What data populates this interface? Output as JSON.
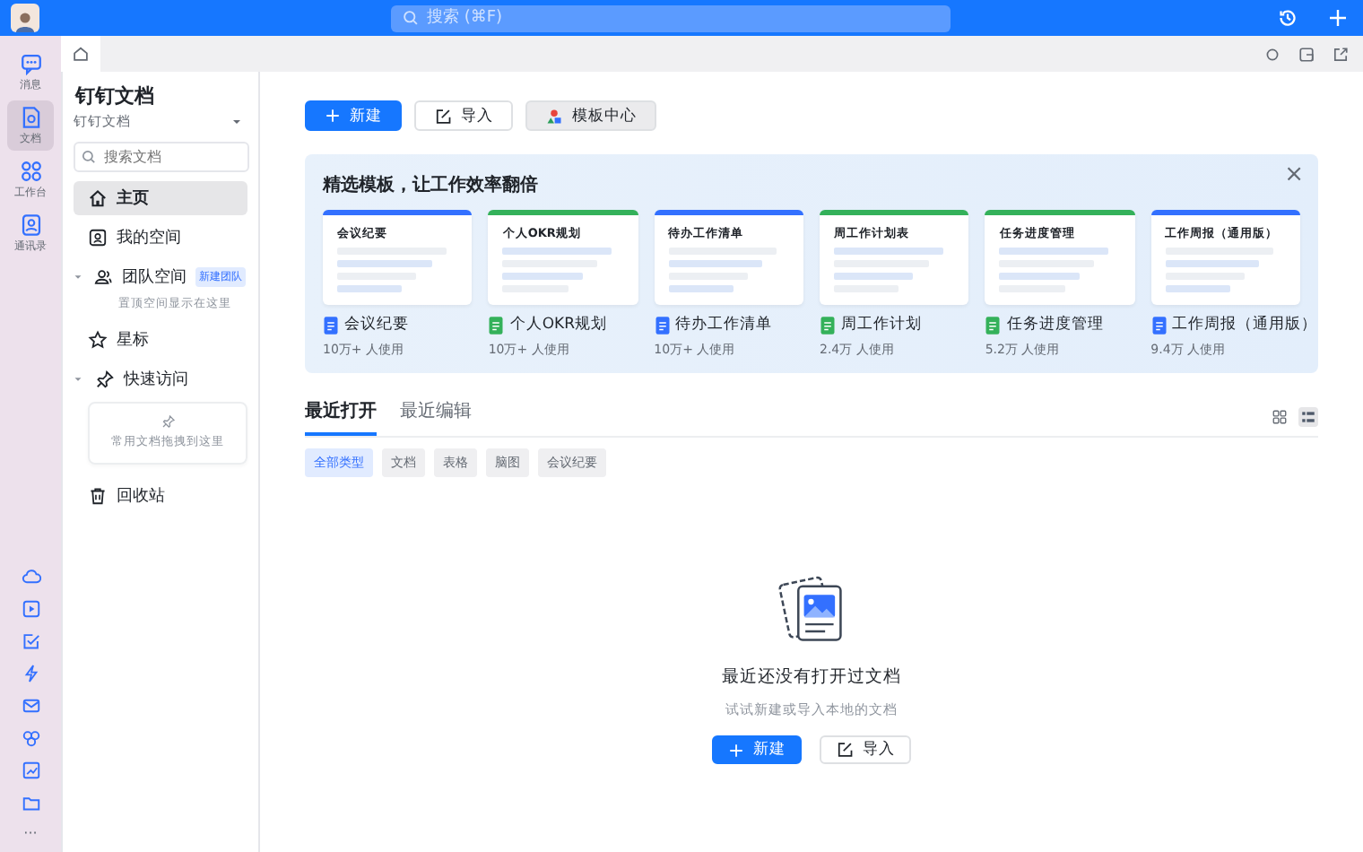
{
  "top_bar": {
    "search": {
      "placeholder": "搜索 (⌘F)"
    }
  },
  "rail": {
    "items": [
      {
        "label": "消息",
        "selected": false
      },
      {
        "label": "文档",
        "selected": true
      },
      {
        "label": "工作台",
        "selected": false
      },
      {
        "label": "通讯录",
        "selected": false
      }
    ],
    "more": "···"
  },
  "sidebar": {
    "title": "钉钉文档",
    "subtitle": "钉钉文档",
    "search": {
      "placeholder": "搜索文档"
    },
    "items": [
      {
        "kind": "nav",
        "label": "主页",
        "selected": true
      },
      {
        "kind": "nav",
        "label": "我的空间",
        "selected": false
      },
      {
        "kind": "group",
        "label": "团队空间",
        "expanded": true,
        "badge": "新建团队",
        "hint": "置顶空间显示在这里"
      },
      {
        "kind": "nav",
        "label": "星标",
        "selected": false
      },
      {
        "kind": "group",
        "label": "快速访问",
        "expanded": true,
        "drop_hint": "常用文档拖拽到这里"
      },
      {
        "kind": "nav",
        "label": "回收站",
        "selected": false
      }
    ]
  },
  "toolbar": {
    "buttons": [
      {
        "kind": "primary",
        "label": "新建"
      },
      {
        "kind": "import",
        "label": "导入"
      },
      {
        "kind": "template",
        "label": "模板中心"
      }
    ]
  },
  "banner": {
    "title": "精选模板，让工作效率翻倍",
    "close": "×",
    "cards": [
      {
        "kind": "doc",
        "preview_title": "会议纪要",
        "name": "会议纪要",
        "usage": "10万+ 人使用"
      },
      {
        "kind": "sheet",
        "preview_title": "个人OKR规划",
        "name": "个人OKR规划",
        "usage": "10万+ 人使用"
      },
      {
        "kind": "doc",
        "preview_title": "待办工作清单",
        "name": "待办工作清单",
        "usage": "10万+ 人使用"
      },
      {
        "kind": "sheet",
        "preview_title": "周工作计划表",
        "name": "周工作计划",
        "usage": "2.4万 人使用"
      },
      {
        "kind": "sheet",
        "preview_title": "任务进度管理",
        "name": "任务进度管理",
        "usage": "5.2万 人使用"
      },
      {
        "kind": "doc",
        "preview_title": "工作周报（通用版）",
        "name": "工作周报（通用版）",
        "usage": "9.4万 人使用"
      }
    ]
  },
  "recent": {
    "tabs": [
      {
        "label": "最近打开",
        "selected": true
      },
      {
        "label": "最近编辑",
        "selected": false
      }
    ],
    "views": [
      {
        "kind": "grid",
        "selected": false
      },
      {
        "kind": "list",
        "selected": true
      }
    ],
    "filters": [
      {
        "label": "全部类型",
        "selected": true
      },
      {
        "label": "文档",
        "selected": false
      },
      {
        "label": "表格",
        "selected": false
      },
      {
        "label": "脑图",
        "selected": false
      },
      {
        "label": "会议纪要",
        "selected": false
      }
    ],
    "empty": {
      "title": "最近还没有打开过文档",
      "hint": "试试新建或导入本地的文档",
      "buttons": [
        {
          "kind": "primary",
          "label": "新建"
        },
        {
          "kind": "import",
          "label": "导入"
        }
      ]
    }
  }
}
